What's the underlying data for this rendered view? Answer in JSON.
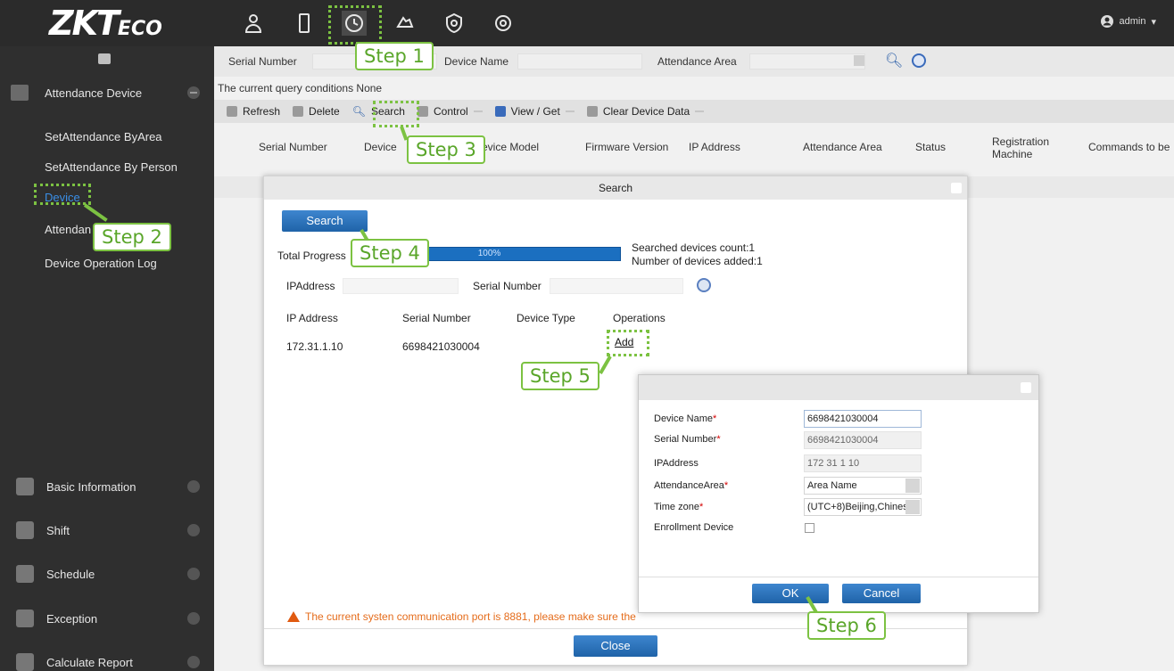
{
  "topbar": {
    "logo_main": "ZKT",
    "logo_eco": "ECO",
    "icons": [
      "person-icon",
      "device-icon",
      "clock-icon",
      "hand-icon",
      "shield-icon",
      "gear-icon"
    ],
    "user_label": "admin"
  },
  "sidebar": {
    "group_title": "Attendance Device",
    "items": [
      {
        "label": "SetAttendance ByArea"
      },
      {
        "label": "SetAttendance By Person"
      },
      {
        "label": "Device"
      },
      {
        "label": "Attendan"
      },
      {
        "label": "Device Operation Log"
      }
    ],
    "bottom": [
      {
        "label": "Basic Information"
      },
      {
        "label": "Shift"
      },
      {
        "label": "Schedule"
      },
      {
        "label": "Exception"
      },
      {
        "label": "Calculate Report"
      }
    ]
  },
  "query": {
    "serial_number_label": "Serial Number",
    "device_name_label": "Device Name",
    "attendance_area_label": "Attendance Area",
    "conditions_text": "The current query conditions None"
  },
  "toolbar": {
    "refresh": "Refresh",
    "delete": "Delete",
    "search": "Search",
    "control": "Control",
    "view_get": "View / Get",
    "clear": "Clear Device Data"
  },
  "table_headers": {
    "serial_number": "Serial Number",
    "device": "Device",
    "device_model": "evice Model",
    "firmware": "Firmware Version",
    "ip": "IP Address",
    "area": "Attendance Area",
    "status": "Status",
    "registration": "Registration",
    "registration2": "Machine",
    "commands": "Commands to be"
  },
  "search_dialog": {
    "title": "Search",
    "search_button": "Search",
    "total_progress_label": "Total Progress",
    "progress_text": "100%",
    "progress_fraction": 1.0,
    "searched_count": "Searched devices count:1",
    "added_count": "Number of devices added:1",
    "filter_ip_label": "IPAddress",
    "filter_serial_label": "Serial Number",
    "columns": {
      "ip": "IP Address",
      "serial": "Serial Number",
      "type": "Device Type",
      "ops": "Operations"
    },
    "rows": [
      {
        "ip": "172.31.1.10",
        "serial": "6698421030004",
        "type": "",
        "op": "Add"
      }
    ],
    "warning": "The current systen communication port is 8881, please make sure the",
    "close_button": "Close"
  },
  "add_dialog": {
    "device_name_label": "Device Name",
    "device_name_value": "6698421030004",
    "serial_label": "Serial Number",
    "serial_value": "6698421030004",
    "ip_label": "IPAddress",
    "ip_value": "172   31   1   10",
    "area_label": "AttendanceArea",
    "area_value": "Area Name",
    "timezone_label": "Time zone",
    "timezone_value": "(UTC+8)Beijing,Chines",
    "enroll_label": "Enrollment Device",
    "ok": "OK",
    "cancel": "Cancel"
  },
  "steps": {
    "s1": "Step 1",
    "s2": "Step 2",
    "s3": "Step 3",
    "s4": "Step 4",
    "s5": "Step 5",
    "s6": "Step 6"
  },
  "colors": {
    "accent_blue": "#1f63a8",
    "step_green": "#7cc242",
    "warning_orange": "#e56c1b",
    "sidebar_bg": "#2f2f2f"
  }
}
